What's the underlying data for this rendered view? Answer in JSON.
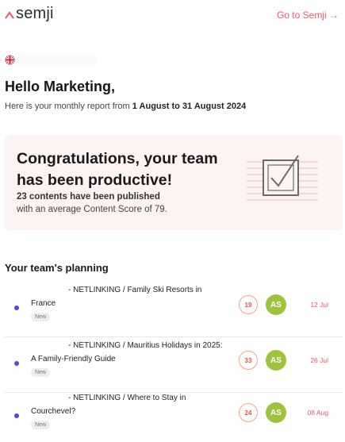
{
  "header": {
    "logo_text": "semji",
    "goto_label": "Go to Semji →"
  },
  "greeting": {
    "title": "Hello Marketing,",
    "report_prefix": "Here is your monthly report from ",
    "date_start": "1 August",
    "report_mid": " to ",
    "date_end": "31 August 2024"
  },
  "congrats": {
    "title": "Congratulations, your team has been productive!",
    "count_text": "23 contents have been published",
    "score_text": "with an average Content Score of 79."
  },
  "planning": {
    "title": "Your team's planning",
    "items": [
      {
        "line1": "- NETLINKING / Family Ski Resorts in",
        "line2": "France",
        "badge": "New",
        "score": "19",
        "assignee": "AS",
        "date": "12 Jul"
      },
      {
        "line1": "- NETLINKING / Mauritius Holidays in 2025:",
        "line2": "A Family-Friendly Guide",
        "badge": "New",
        "score": "33",
        "assignee": "AS",
        "date": "26 Jul"
      },
      {
        "line1": "- NETLINKING / Where to Stay in",
        "line2": "Courchevel?",
        "badge": "New",
        "score": "24",
        "assignee": "AS",
        "date": "08 Aug"
      }
    ]
  },
  "colors": {
    "accent": "#f0586a",
    "bullet": "#4b4ce6",
    "avatar": "#9ec33c",
    "congrats_bg": "#fdf3f2"
  },
  "icons": {
    "logo": "semji-chevron-icon",
    "flag": "uk-flag-icon",
    "illustration": "checked-box-illustration"
  }
}
